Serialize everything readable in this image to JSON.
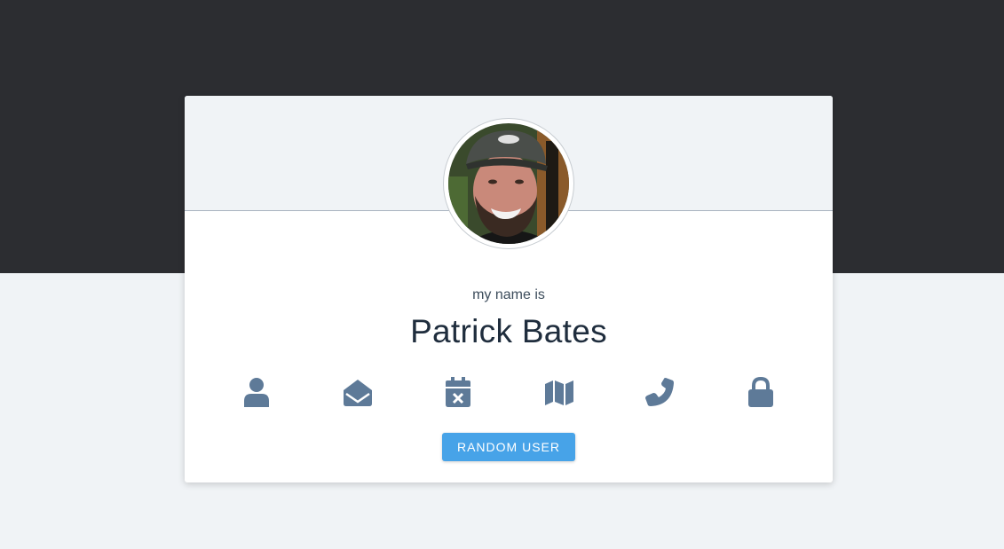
{
  "colors": {
    "top_band": "#2c2d31",
    "page_background": "#f0f3f6",
    "card_background": "#ffffff",
    "icon": "#5e7a98",
    "button": "#47a3e8"
  },
  "profile": {
    "label": "my name is",
    "value": "Patrick Bates",
    "avatar": "user-photo"
  },
  "icons": [
    {
      "name": "user-icon"
    },
    {
      "name": "envelope-open-icon"
    },
    {
      "name": "calendar-x-icon"
    },
    {
      "name": "map-icon"
    },
    {
      "name": "phone-icon"
    },
    {
      "name": "lock-icon"
    }
  ],
  "actions": {
    "random_user_label": "RANDOM USER"
  }
}
